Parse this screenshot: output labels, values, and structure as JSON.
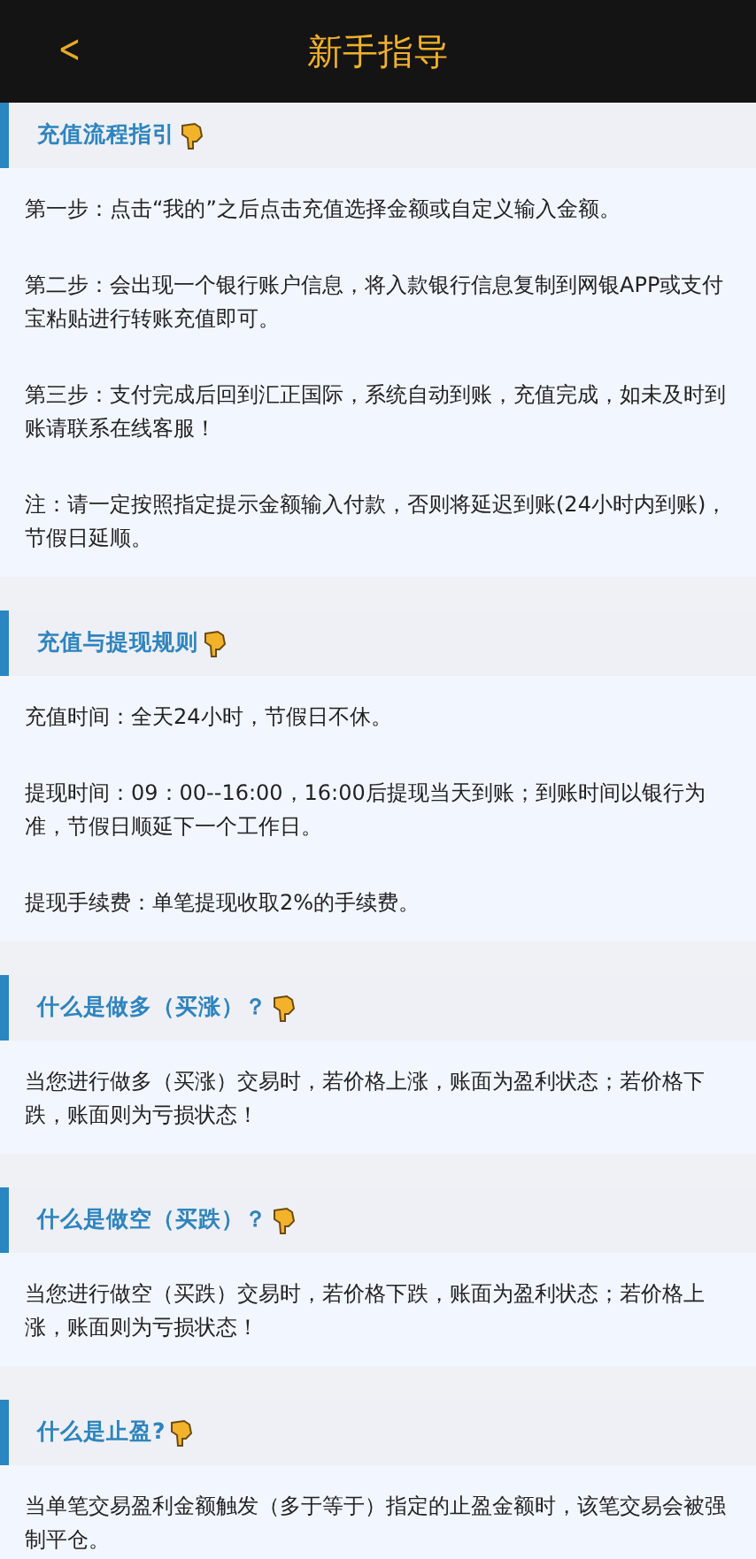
{
  "header": {
    "back": "<",
    "title": "新手指导"
  },
  "sections": [
    {
      "title": "充值流程指引",
      "paragraphs": [
        "第一步：点击“我的”之后点击充值选择金额或自定义输入金额。",
        "第二步：会出现一个银行账户信息，将入款银行信息复制到网银APP或支付宝粘贴进行转账充值即可。",
        "第三步：支付完成后回到汇正国际，系统自动到账，充值完成，如未及时到账请联系在线客服！",
        "注：请一定按照指定提示金额输入付款，否则将延迟到账(24小时内到账)，节假日延顺。"
      ]
    },
    {
      "title": "充值与提现规则",
      "paragraphs": [
        "充值时间：全天24小时，节假日不休。",
        "提现时间：09：00--16:00，16:00后提现当天到账；到账时间以银行为准，节假日顺延下一个工作日。",
        "提现手续费：单笔提现收取2%的手续费。"
      ]
    },
    {
      "title": "什么是做多（买涨）？",
      "paragraphs": [
        "当您进行做多（买涨）交易时，若价格上涨，账面为盈利状态；若价格下跌，账面则为亏损状态！"
      ]
    },
    {
      "title": "什么是做空（买跌）？",
      "paragraphs": [
        "当您进行做空（买跌）交易时，若价格下跌，账面为盈利状态；若价格上涨，账面则为亏损状态！"
      ]
    },
    {
      "title": "什么是止盈?",
      "paragraphs": [
        "当单笔交易盈利金额触发（多于等于）指定的止盈金额时，该笔交易会被强制平仓。"
      ]
    }
  ]
}
